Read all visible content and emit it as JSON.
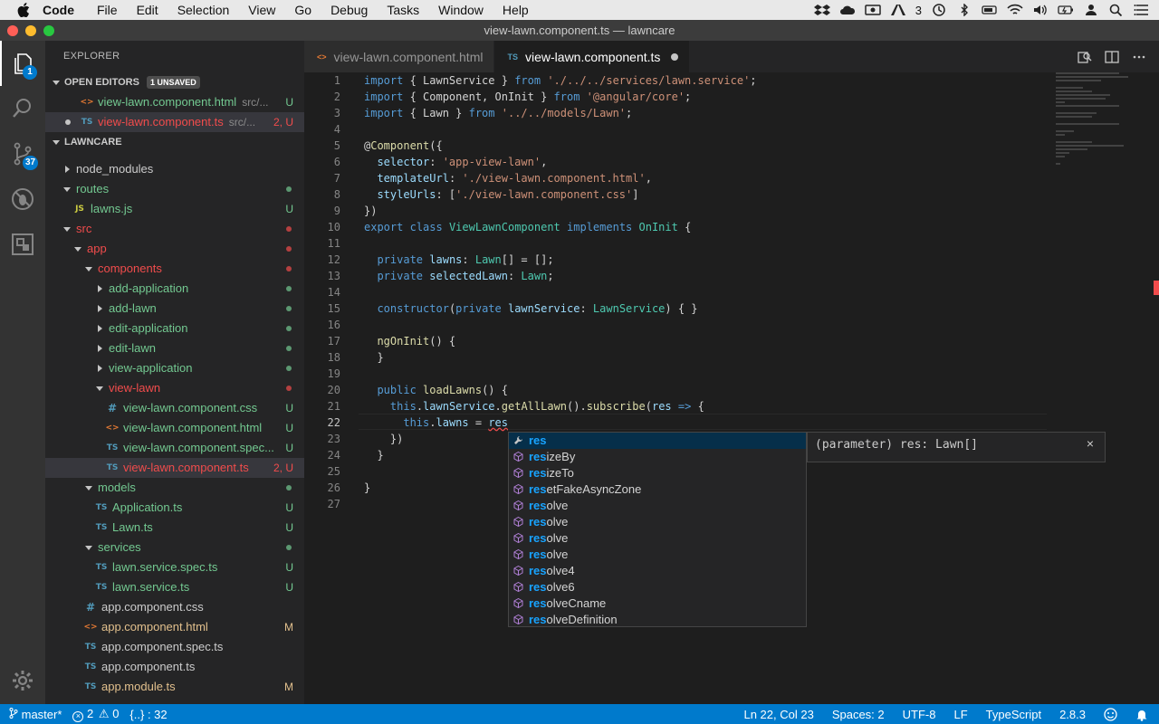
{
  "menubar": {
    "app": "Code",
    "items": [
      "File",
      "Edit",
      "Selection",
      "View",
      "Go",
      "Debug",
      "Tasks",
      "Window",
      "Help"
    ],
    "tray_count": "3"
  },
  "window": {
    "title": "view-lawn.component.ts — lawncare"
  },
  "activity": {
    "explorer_badge": "1",
    "scm_badge": "37"
  },
  "sidebar": {
    "title": "EXPLORER",
    "open_editors": {
      "label": "OPEN EDITORS",
      "unsaved": "1 UNSAVED",
      "items": [
        {
          "name": "view-lawn.component.html",
          "desc": "src/...",
          "status": "U",
          "type": "html"
        },
        {
          "name": "view-lawn.component.ts",
          "desc": "src/...",
          "status": "2, U",
          "type": "ts"
        }
      ]
    },
    "project": {
      "label": "LAWNCARE"
    },
    "tree": [
      {
        "name": "node_modules",
        "indent": 0,
        "kind": "folder-closed",
        "color": "grey",
        "status": ""
      },
      {
        "name": "routes",
        "indent": 0,
        "kind": "folder-open",
        "color": "green",
        "status": "dot"
      },
      {
        "name": "lawns.js",
        "indent": 1,
        "kind": "js",
        "color": "green",
        "status": "U"
      },
      {
        "name": "src",
        "indent": 0,
        "kind": "folder-open",
        "color": "red",
        "status": "dot"
      },
      {
        "name": "app",
        "indent": 1,
        "kind": "folder-open",
        "color": "red",
        "status": "dot"
      },
      {
        "name": "components",
        "indent": 2,
        "kind": "folder-open",
        "color": "red",
        "status": "dot"
      },
      {
        "name": "add-application",
        "indent": 3,
        "kind": "folder-closed",
        "color": "green",
        "status": "dot"
      },
      {
        "name": "add-lawn",
        "indent": 3,
        "kind": "folder-closed",
        "color": "green",
        "status": "dot"
      },
      {
        "name": "edit-application",
        "indent": 3,
        "kind": "folder-closed",
        "color": "green",
        "status": "dot"
      },
      {
        "name": "edit-lawn",
        "indent": 3,
        "kind": "folder-closed",
        "color": "green",
        "status": "dot"
      },
      {
        "name": "view-application",
        "indent": 3,
        "kind": "folder-closed",
        "color": "green",
        "status": "dot"
      },
      {
        "name": "view-lawn",
        "indent": 3,
        "kind": "folder-open",
        "color": "red",
        "status": "dot"
      },
      {
        "name": "view-lawn.component.css",
        "indent": 4,
        "kind": "css",
        "color": "green",
        "status": "U"
      },
      {
        "name": "view-lawn.component.html",
        "indent": 4,
        "kind": "html",
        "color": "green",
        "status": "U"
      },
      {
        "name": "view-lawn.component.spec...",
        "indent": 4,
        "kind": "ts",
        "color": "green",
        "status": "U"
      },
      {
        "name": "view-lawn.component.ts",
        "indent": 4,
        "kind": "ts",
        "color": "red",
        "status": "2, U",
        "selected": true
      },
      {
        "name": "models",
        "indent": 2,
        "kind": "folder-open",
        "color": "green",
        "status": "dot"
      },
      {
        "name": "Application.ts",
        "indent": 3,
        "kind": "ts",
        "color": "green",
        "status": "U"
      },
      {
        "name": "Lawn.ts",
        "indent": 3,
        "kind": "ts",
        "color": "green",
        "status": "U"
      },
      {
        "name": "services",
        "indent": 2,
        "kind": "folder-open",
        "color": "green",
        "status": "dot"
      },
      {
        "name": "lawn.service.spec.ts",
        "indent": 3,
        "kind": "ts",
        "color": "green",
        "status": "U"
      },
      {
        "name": "lawn.service.ts",
        "indent": 3,
        "kind": "ts",
        "color": "green",
        "status": "U"
      },
      {
        "name": "app.component.css",
        "indent": 2,
        "kind": "css",
        "color": "grey",
        "status": ""
      },
      {
        "name": "app.component.html",
        "indent": 2,
        "kind": "html",
        "color": "yellow",
        "status": "M"
      },
      {
        "name": "app.component.spec.ts",
        "indent": 2,
        "kind": "ts",
        "color": "grey",
        "status": ""
      },
      {
        "name": "app.component.ts",
        "indent": 2,
        "kind": "ts",
        "color": "grey",
        "status": ""
      },
      {
        "name": "app.module.ts",
        "indent": 2,
        "kind": "ts",
        "color": "yellow",
        "status": "M"
      }
    ]
  },
  "tabs": [
    {
      "label": "view-lawn.component.html",
      "type": "html",
      "active": false
    },
    {
      "label": "view-lawn.component.ts",
      "type": "ts",
      "active": true,
      "dirty": true
    }
  ],
  "editor": {
    "lines": [
      [
        [
          "k",
          "import"
        ],
        [
          "p",
          " { LawnService } "
        ],
        [
          "k",
          "from"
        ],
        [
          "p",
          " "
        ],
        [
          "s",
          "'./../../services/lawn.service'"
        ],
        [
          "p",
          ";"
        ]
      ],
      [
        [
          "k",
          "import"
        ],
        [
          "p",
          " { Component, OnInit } "
        ],
        [
          "k",
          "from"
        ],
        [
          "p",
          " "
        ],
        [
          "s",
          "'@angular/core'"
        ],
        [
          "p",
          ";"
        ]
      ],
      [
        [
          "k",
          "import"
        ],
        [
          "p",
          " { Lawn } "
        ],
        [
          "k",
          "from"
        ],
        [
          "p",
          " "
        ],
        [
          "s",
          "'../../models/Lawn'"
        ],
        [
          "p",
          ";"
        ]
      ],
      [],
      [
        [
          "p",
          "@"
        ],
        [
          "f",
          "Component"
        ],
        [
          "p",
          "({"
        ]
      ],
      [
        [
          "p",
          "  "
        ],
        [
          "v",
          "selector"
        ],
        [
          "p",
          ": "
        ],
        [
          "s",
          "'app-view-lawn'"
        ],
        [
          "p",
          ","
        ]
      ],
      [
        [
          "p",
          "  "
        ],
        [
          "v",
          "templateUrl"
        ],
        [
          "p",
          ": "
        ],
        [
          "s",
          "'./view-lawn.component.html'"
        ],
        [
          "p",
          ","
        ]
      ],
      [
        [
          "p",
          "  "
        ],
        [
          "v",
          "styleUrls"
        ],
        [
          "p",
          ": ["
        ],
        [
          "s",
          "'./view-lawn.component.css'"
        ],
        [
          "p",
          "]"
        ]
      ],
      [
        [
          "p",
          "})"
        ]
      ],
      [
        [
          "k",
          "export"
        ],
        [
          "p",
          " "
        ],
        [
          "k",
          "class"
        ],
        [
          "p",
          " "
        ],
        [
          "t",
          "ViewLawnComponent"
        ],
        [
          "p",
          " "
        ],
        [
          "k",
          "implements"
        ],
        [
          "p",
          " "
        ],
        [
          "t",
          "OnInit"
        ],
        [
          "p",
          " {"
        ]
      ],
      [],
      [
        [
          "p",
          "  "
        ],
        [
          "k",
          "private"
        ],
        [
          "p",
          " "
        ],
        [
          "v",
          "lawns"
        ],
        [
          "p",
          ": "
        ],
        [
          "t",
          "Lawn"
        ],
        [
          "p",
          "[] = [];"
        ]
      ],
      [
        [
          "p",
          "  "
        ],
        [
          "k",
          "private"
        ],
        [
          "p",
          " "
        ],
        [
          "v",
          "selectedLawn"
        ],
        [
          "p",
          ": "
        ],
        [
          "t",
          "Lawn"
        ],
        [
          "p",
          ";"
        ]
      ],
      [],
      [
        [
          "p",
          "  "
        ],
        [
          "k",
          "constructor"
        ],
        [
          "p",
          "("
        ],
        [
          "k",
          "private"
        ],
        [
          "p",
          " "
        ],
        [
          "v",
          "lawnService"
        ],
        [
          "p",
          ": "
        ],
        [
          "t",
          "LawnService"
        ],
        [
          "p",
          ") { }"
        ]
      ],
      [],
      [
        [
          "p",
          "  "
        ],
        [
          "f",
          "ngOnInit"
        ],
        [
          "p",
          "() {"
        ]
      ],
      [
        [
          "p",
          "  }"
        ]
      ],
      [],
      [
        [
          "p",
          "  "
        ],
        [
          "k",
          "public"
        ],
        [
          "p",
          " "
        ],
        [
          "f",
          "loadLawns"
        ],
        [
          "p",
          "() {"
        ]
      ],
      [
        [
          "p",
          "    "
        ],
        [
          "k",
          "this"
        ],
        [
          "p",
          "."
        ],
        [
          "v",
          "lawnService"
        ],
        [
          "p",
          "."
        ],
        [
          "f",
          "getAllLawn"
        ],
        [
          "p",
          "()."
        ],
        [
          "f",
          "subscribe"
        ],
        [
          "p",
          "("
        ],
        [
          "v",
          "res"
        ],
        [
          "p",
          " "
        ],
        [
          "k",
          "=>"
        ],
        [
          "p",
          " {"
        ]
      ],
      [
        [
          "p",
          "      "
        ],
        [
          "k",
          "this"
        ],
        [
          "p",
          "."
        ],
        [
          "v",
          "lawns"
        ],
        [
          "p",
          " = "
        ],
        [
          "sq",
          "res"
        ]
      ],
      [
        [
          "p",
          "    })"
        ]
      ],
      [
        [
          "p",
          "  }"
        ]
      ],
      [],
      [
        [
          "p",
          "}"
        ]
      ],
      []
    ],
    "cursor_line": 22
  },
  "suggest": {
    "prefix": "res",
    "items": [
      {
        "rest": "",
        "icon": "wrench",
        "focused": true
      },
      {
        "rest": "izeBy",
        "icon": "cube"
      },
      {
        "rest": "izeTo",
        "icon": "cube"
      },
      {
        "rest": "etFakeAsyncZone",
        "icon": "cube"
      },
      {
        "rest": "olve",
        "icon": "cube"
      },
      {
        "rest": "olve",
        "icon": "cube"
      },
      {
        "rest": "olve",
        "icon": "cube"
      },
      {
        "rest": "olve",
        "icon": "cube"
      },
      {
        "rest": "olve4",
        "icon": "cube"
      },
      {
        "rest": "olve6",
        "icon": "cube"
      },
      {
        "rest": "olveCname",
        "icon": "cube"
      },
      {
        "rest": "olveDefinition",
        "icon": "cube"
      }
    ],
    "detail": "(parameter) res: Lawn[]",
    "close": "×"
  },
  "statusbar": {
    "branch": "master*",
    "errors": "2",
    "warnings": "0",
    "braces": "{..} : 32",
    "position": "Ln 22, Col 23",
    "spaces": "Spaces: 2",
    "encoding": "UTF-8",
    "eol": "LF",
    "language": "TypeScript",
    "version": "2.8.3"
  },
  "colors": {
    "accent": "#007acc",
    "error": "#f14c4c",
    "untracked": "#73c991",
    "modified": "#e2c08d"
  }
}
